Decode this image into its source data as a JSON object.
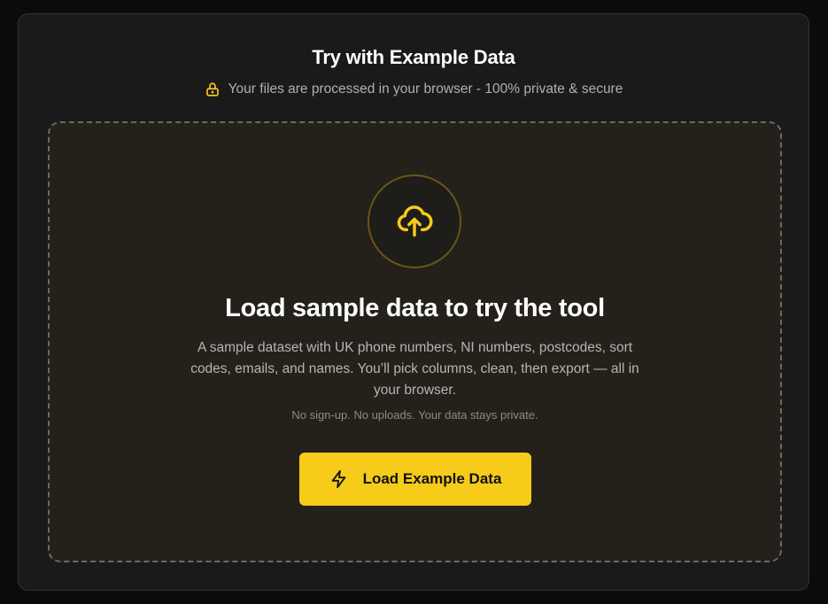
{
  "header": {
    "title": "Try with Example Data",
    "privacy_text": "Your files are processed in your browser - 100% private & secure",
    "privacy_icon": "lock-icon"
  },
  "dropzone": {
    "icon": "cloud-upload-icon",
    "heading": "Load sample data to try the tool",
    "description": "A sample dataset with UK phone numbers, NI numbers, postcodes, sort codes, emails, and names. You’ll pick columns, clean, then export — all in your browser.",
    "note": "No sign-up. No uploads. Your data stays private.",
    "button_label": "Load Example Data",
    "button_icon": "lightning-bolt-icon"
  },
  "colors": {
    "accent": "#f6cb1a",
    "page_background": "#0b0b0b",
    "card_background": "#1a1a1a",
    "dropzone_background": "#23211a"
  }
}
